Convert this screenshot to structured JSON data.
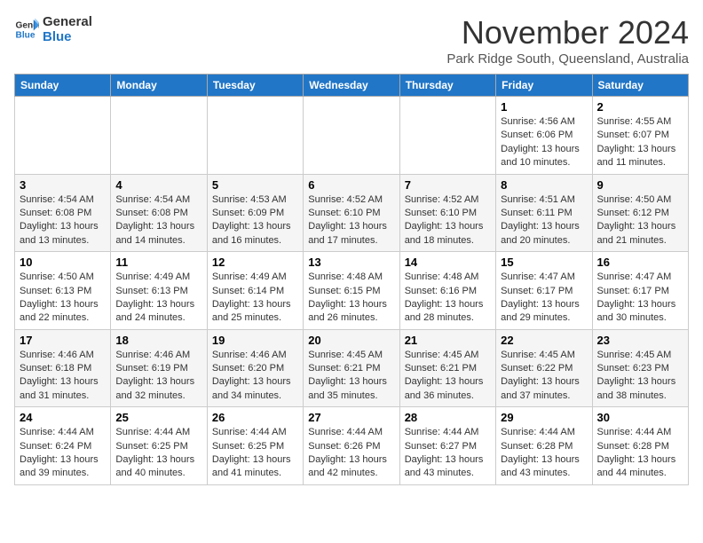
{
  "logo": {
    "line1": "General",
    "line2": "Blue"
  },
  "title": "November 2024",
  "subtitle": "Park Ridge South, Queensland, Australia",
  "days_of_week": [
    "Sunday",
    "Monday",
    "Tuesday",
    "Wednesday",
    "Thursday",
    "Friday",
    "Saturday"
  ],
  "weeks": [
    [
      {
        "day": "",
        "info": ""
      },
      {
        "day": "",
        "info": ""
      },
      {
        "day": "",
        "info": ""
      },
      {
        "day": "",
        "info": ""
      },
      {
        "day": "",
        "info": ""
      },
      {
        "day": "1",
        "info": "Sunrise: 4:56 AM\nSunset: 6:06 PM\nDaylight: 13 hours\nand 10 minutes."
      },
      {
        "day": "2",
        "info": "Sunrise: 4:55 AM\nSunset: 6:07 PM\nDaylight: 13 hours\nand 11 minutes."
      }
    ],
    [
      {
        "day": "3",
        "info": "Sunrise: 4:54 AM\nSunset: 6:08 PM\nDaylight: 13 hours\nand 13 minutes."
      },
      {
        "day": "4",
        "info": "Sunrise: 4:54 AM\nSunset: 6:08 PM\nDaylight: 13 hours\nand 14 minutes."
      },
      {
        "day": "5",
        "info": "Sunrise: 4:53 AM\nSunset: 6:09 PM\nDaylight: 13 hours\nand 16 minutes."
      },
      {
        "day": "6",
        "info": "Sunrise: 4:52 AM\nSunset: 6:10 PM\nDaylight: 13 hours\nand 17 minutes."
      },
      {
        "day": "7",
        "info": "Sunrise: 4:52 AM\nSunset: 6:10 PM\nDaylight: 13 hours\nand 18 minutes."
      },
      {
        "day": "8",
        "info": "Sunrise: 4:51 AM\nSunset: 6:11 PM\nDaylight: 13 hours\nand 20 minutes."
      },
      {
        "day": "9",
        "info": "Sunrise: 4:50 AM\nSunset: 6:12 PM\nDaylight: 13 hours\nand 21 minutes."
      }
    ],
    [
      {
        "day": "10",
        "info": "Sunrise: 4:50 AM\nSunset: 6:13 PM\nDaylight: 13 hours\nand 22 minutes."
      },
      {
        "day": "11",
        "info": "Sunrise: 4:49 AM\nSunset: 6:13 PM\nDaylight: 13 hours\nand 24 minutes."
      },
      {
        "day": "12",
        "info": "Sunrise: 4:49 AM\nSunset: 6:14 PM\nDaylight: 13 hours\nand 25 minutes."
      },
      {
        "day": "13",
        "info": "Sunrise: 4:48 AM\nSunset: 6:15 PM\nDaylight: 13 hours\nand 26 minutes."
      },
      {
        "day": "14",
        "info": "Sunrise: 4:48 AM\nSunset: 6:16 PM\nDaylight: 13 hours\nand 28 minutes."
      },
      {
        "day": "15",
        "info": "Sunrise: 4:47 AM\nSunset: 6:17 PM\nDaylight: 13 hours\nand 29 minutes."
      },
      {
        "day": "16",
        "info": "Sunrise: 4:47 AM\nSunset: 6:17 PM\nDaylight: 13 hours\nand 30 minutes."
      }
    ],
    [
      {
        "day": "17",
        "info": "Sunrise: 4:46 AM\nSunset: 6:18 PM\nDaylight: 13 hours\nand 31 minutes."
      },
      {
        "day": "18",
        "info": "Sunrise: 4:46 AM\nSunset: 6:19 PM\nDaylight: 13 hours\nand 32 minutes."
      },
      {
        "day": "19",
        "info": "Sunrise: 4:46 AM\nSunset: 6:20 PM\nDaylight: 13 hours\nand 34 minutes."
      },
      {
        "day": "20",
        "info": "Sunrise: 4:45 AM\nSunset: 6:21 PM\nDaylight: 13 hours\nand 35 minutes."
      },
      {
        "day": "21",
        "info": "Sunrise: 4:45 AM\nSunset: 6:21 PM\nDaylight: 13 hours\nand 36 minutes."
      },
      {
        "day": "22",
        "info": "Sunrise: 4:45 AM\nSunset: 6:22 PM\nDaylight: 13 hours\nand 37 minutes."
      },
      {
        "day": "23",
        "info": "Sunrise: 4:45 AM\nSunset: 6:23 PM\nDaylight: 13 hours\nand 38 minutes."
      }
    ],
    [
      {
        "day": "24",
        "info": "Sunrise: 4:44 AM\nSunset: 6:24 PM\nDaylight: 13 hours\nand 39 minutes."
      },
      {
        "day": "25",
        "info": "Sunrise: 4:44 AM\nSunset: 6:25 PM\nDaylight: 13 hours\nand 40 minutes."
      },
      {
        "day": "26",
        "info": "Sunrise: 4:44 AM\nSunset: 6:25 PM\nDaylight: 13 hours\nand 41 minutes."
      },
      {
        "day": "27",
        "info": "Sunrise: 4:44 AM\nSunset: 6:26 PM\nDaylight: 13 hours\nand 42 minutes."
      },
      {
        "day": "28",
        "info": "Sunrise: 4:44 AM\nSunset: 6:27 PM\nDaylight: 13 hours\nand 43 minutes."
      },
      {
        "day": "29",
        "info": "Sunrise: 4:44 AM\nSunset: 6:28 PM\nDaylight: 13 hours\nand 43 minutes."
      },
      {
        "day": "30",
        "info": "Sunrise: 4:44 AM\nSunset: 6:28 PM\nDaylight: 13 hours\nand 44 minutes."
      }
    ]
  ]
}
